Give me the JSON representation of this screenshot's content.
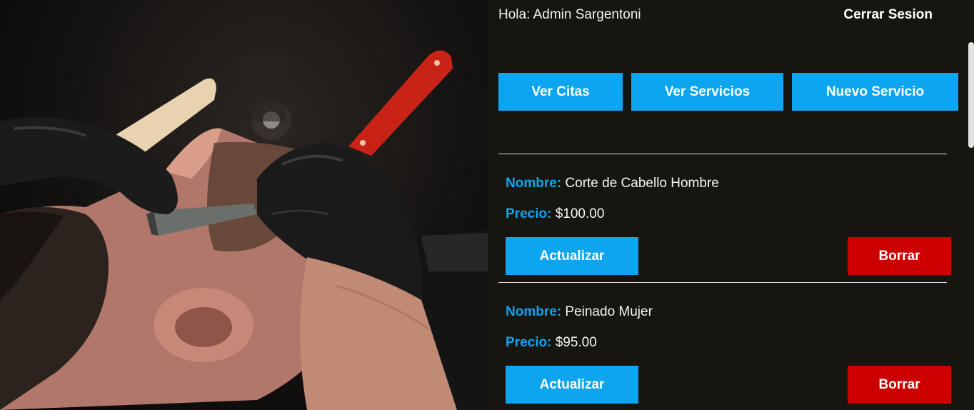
{
  "header": {
    "greeting": "Hola: Admin Sargentoni",
    "logout_label": "Cerrar Sesion"
  },
  "nav": {
    "buttons": [
      {
        "label": "Ver Citas"
      },
      {
        "label": "Ver Servicios"
      },
      {
        "label": "Nuevo Servicio"
      }
    ]
  },
  "services": [
    {
      "name_label": "Nombre:",
      "name": "Corte de Cabello Hombre",
      "price_label": "Precio:",
      "price": "$100.00",
      "update_label": "Actualizar",
      "delete_label": "Borrar"
    },
    {
      "name_label": "Nombre:",
      "name": "Peinado Mujer",
      "price_label": "Precio:",
      "price": "$95.00",
      "update_label": "Actualizar",
      "delete_label": "Borrar"
    }
  ],
  "colors": {
    "background": "#161510",
    "accent": "#0da5f0",
    "danger": "#cc0000",
    "text": "#ffffff"
  },
  "hero_image": {
    "icon": "barber-shaving-photo"
  }
}
